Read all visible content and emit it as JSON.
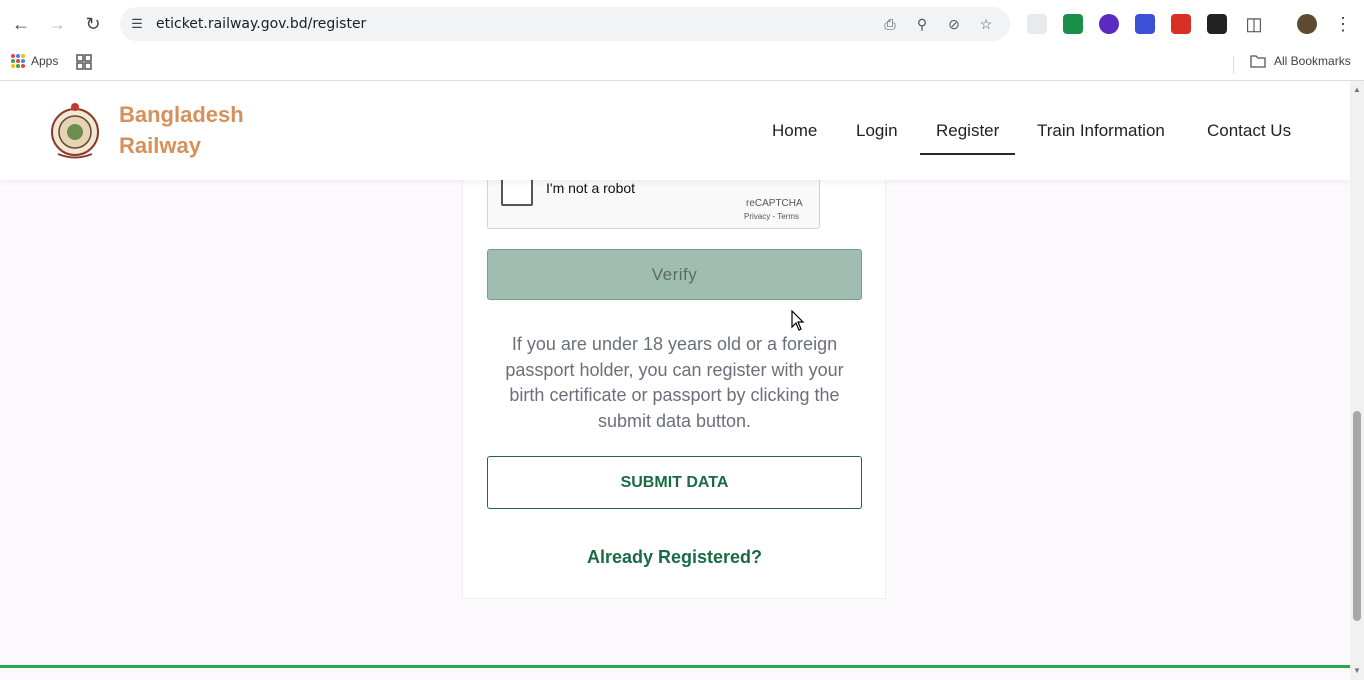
{
  "browser": {
    "url": "eticket.railway.gov.bd/register",
    "bookmarks": {
      "apps_label": "Apps",
      "all_bookmarks_label": "All Bookmarks"
    },
    "extension_colors": [
      "#e8eaed",
      "#1a8f4a",
      "#5b2bbf",
      "#3c4fd6",
      "#d93025",
      "#222222"
    ]
  },
  "site": {
    "brand_line1": "Bangladesh",
    "brand_line2": "Railway",
    "nav": {
      "home": "Home",
      "login": "Login",
      "register": "Register",
      "train_information": "Train Information",
      "contact_us": "Contact Us"
    },
    "active_nav": "Register"
  },
  "form": {
    "recaptcha": {
      "label": "I'm not a robot",
      "brand": "reCAPTCHA",
      "privacy": "Privacy",
      "separator": " - ",
      "terms": "Terms"
    },
    "verify_label": "Verify",
    "info_text": "If you are under 18 years old or a foreign passport holder, you can register with your birth certificate or passport by clicking the submit data button.",
    "submit_label": "SUBMIT DATA",
    "already_registered_label": "Already Registered?"
  },
  "colors": {
    "brand": "#d6905a",
    "accent_green": "#1a6b45",
    "verify_disabled": "#9fbdb0",
    "footer_line": "#27a84a"
  }
}
